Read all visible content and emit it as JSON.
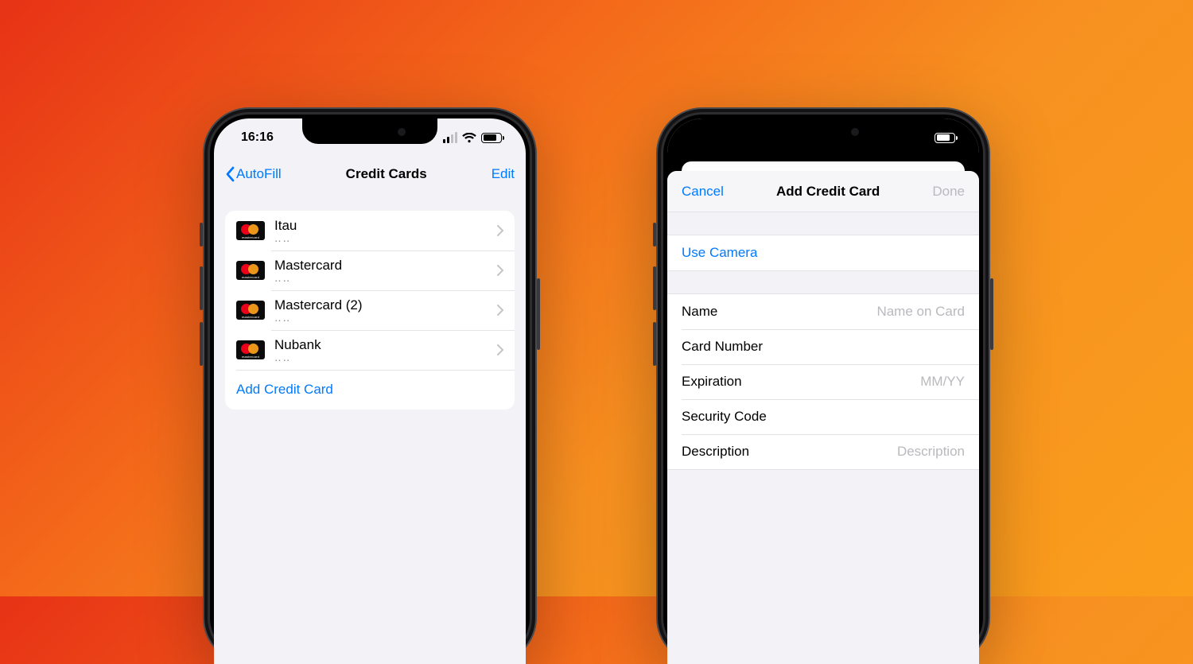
{
  "status": {
    "time": "16:16"
  },
  "left": {
    "back_label": "AutoFill",
    "title": "Credit Cards",
    "edit_label": "Edit",
    "cards": [
      {
        "name": "Itau",
        "mask": "‥‥"
      },
      {
        "name": "Mastercard",
        "mask": "‥‥"
      },
      {
        "name": "Mastercard (2)",
        "mask": "‥‥"
      },
      {
        "name": "Nubank",
        "mask": "‥‥"
      }
    ],
    "add_label": "Add Credit Card"
  },
  "right": {
    "cancel_label": "Cancel",
    "title": "Add Credit Card",
    "done_label": "Done",
    "use_camera_label": "Use Camera",
    "fields": {
      "name_label": "Name",
      "name_placeholder": "Name on Card",
      "number_label": "Card Number",
      "expiration_label": "Expiration",
      "expiration_placeholder": "MM/YY",
      "security_label": "Security Code",
      "description_label": "Description",
      "description_placeholder": "Description"
    }
  }
}
